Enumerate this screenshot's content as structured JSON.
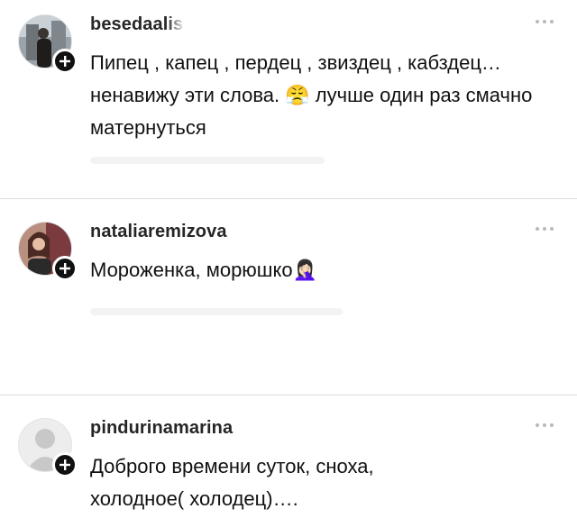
{
  "comments": [
    {
      "username": "besedaalis",
      "text": "Пипец , капец , пердец , звиздец , кабздец… ненавижу эти слова.",
      "emoji": "😤",
      "text_after": " лучше один раз смачно матернуться"
    },
    {
      "username": "nataliaremizova",
      "text": "Мороженка, морюшко",
      "emoji": "🤦🏻‍♀️",
      "text_after": ""
    },
    {
      "username": "pindurinamarina",
      "text": "Доброго времени суток, сноха, холодное( холодец)….",
      "emoji": "",
      "text_after": ""
    }
  ],
  "icons": {
    "follow_badge": "plus-icon",
    "more": "more-horizontal-icon"
  }
}
